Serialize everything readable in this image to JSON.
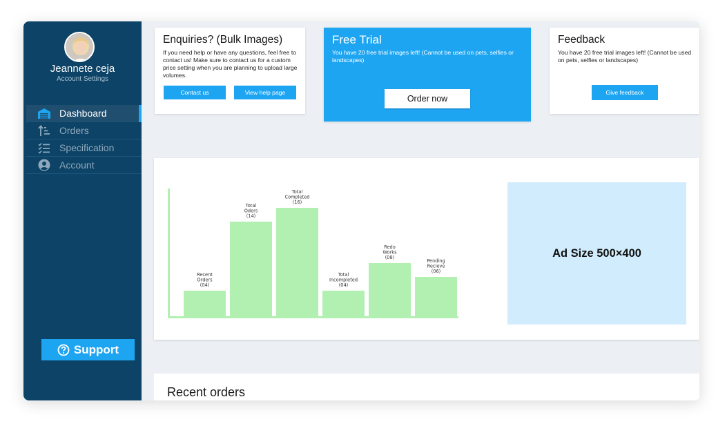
{
  "user": {
    "name": "Jeannete ceja",
    "subtitle": "Account Settings"
  },
  "nav": [
    {
      "label": "Dashboard",
      "icon": "garage-icon",
      "active": true
    },
    {
      "label": "Orders",
      "icon": "sort-ascending-icon",
      "active": false
    },
    {
      "label": "Specification",
      "icon": "checklist-icon",
      "active": false
    },
    {
      "label": "Account",
      "icon": "account-circle-icon",
      "active": false
    }
  ],
  "support": {
    "label": "Support",
    "icon": "question-circle-icon"
  },
  "cards": {
    "enquiries": {
      "title": "Enquiries? (Bulk Images)",
      "text": "If you need help or have any questions, feel free to contact us! Make sure to contact us for a custom price setting when you are planning  to upload large volumes.",
      "contact_label": "Contact us",
      "help_label": "View help page"
    },
    "free_trial": {
      "title": "Free Trial",
      "text": "You have 20 free trial images left! (Cannot be used on pets, selfies or landscapes)",
      "order_label": "Order now"
    },
    "feedback": {
      "title": "Feedback",
      "text": "You have 20 free trial images left! (Cannot be used on pets, selfies or landscapes)",
      "button_label": "Give feedback"
    }
  },
  "chart_data": {
    "type": "bar",
    "categories": [
      "Recent Orders",
      "Total Oders",
      "Total Completed",
      "Total Incompleted",
      "Redo Works",
      "Pending Recieve"
    ],
    "values": [
      4,
      14,
      16,
      4,
      8,
      6
    ],
    "data_labels": [
      [
        "Recent",
        "Orders",
        "(04)"
      ],
      [
        "Total",
        "Oders",
        "(14)"
      ],
      [
        "Total",
        "Completed",
        "(16)"
      ],
      [
        "Total",
        "Incompleted",
        "(04)"
      ],
      [
        "Redo",
        "Works",
        "(08)"
      ],
      [
        "Pending",
        "Recieve",
        "(06)"
      ]
    ],
    "ylim": [
      0,
      18
    ],
    "grid": false,
    "bar_color": "#b2f0b2",
    "axis_color": "#b2f0b2"
  },
  "ad": {
    "label": "Ad Size 500×400"
  },
  "recent_orders": {
    "title": "Recent orders"
  },
  "colors": {
    "sidebar": "#0d4366",
    "accent": "#1ea5f2",
    "ad_background": "#d1ecfc"
  }
}
